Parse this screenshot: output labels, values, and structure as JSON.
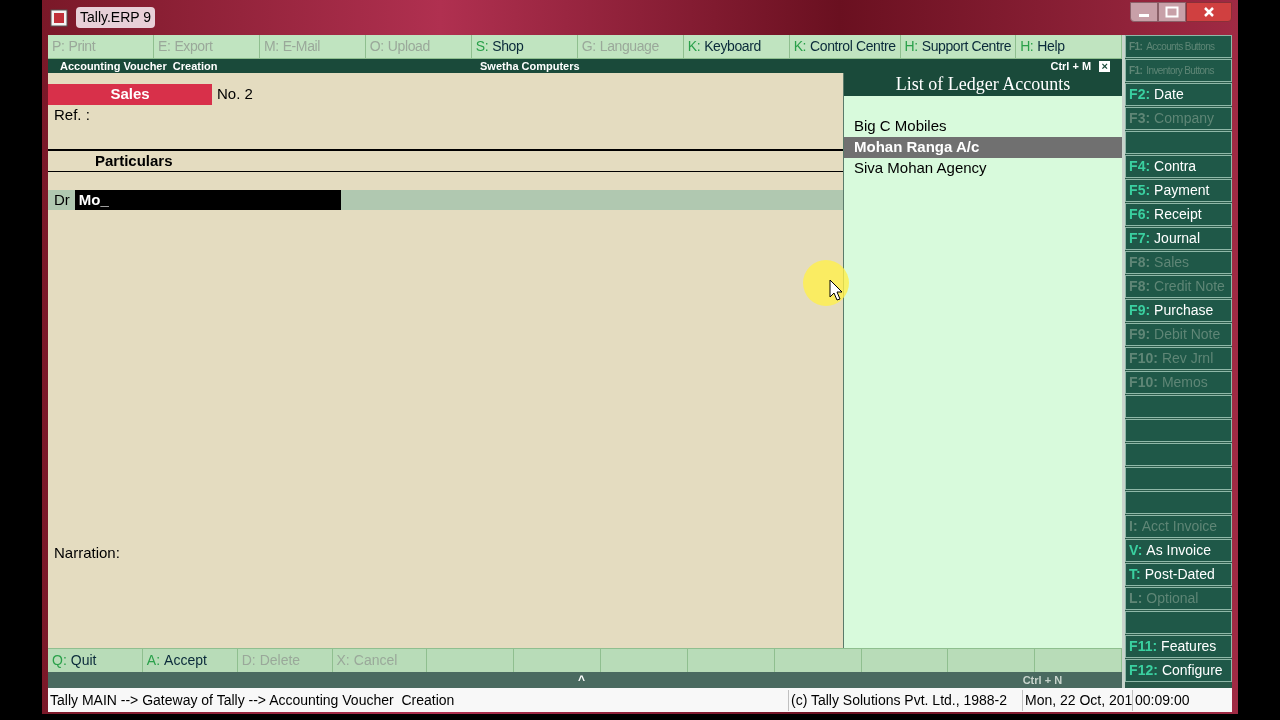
{
  "window": {
    "title": "Tally.ERP 9"
  },
  "top_buttons": [
    {
      "key": "P:",
      "label": "Print",
      "disabled": true
    },
    {
      "key": "E:",
      "label": "Export",
      "disabled": true
    },
    {
      "key": "M:",
      "label": "E-Mail",
      "disabled": true
    },
    {
      "key": "O:",
      "label": "Upload",
      "disabled": true
    },
    {
      "key": "S:",
      "label": "Shop",
      "disabled": false
    },
    {
      "key": "G:",
      "label": "Language",
      "disabled": true
    },
    {
      "key": "K:",
      "label": "Keyboard",
      "disabled": false
    },
    {
      "key": "K:",
      "label": "Control Centre",
      "disabled": false
    },
    {
      "key": "H:",
      "label": "Support Centre",
      "disabled": false
    },
    {
      "key": "H:",
      "label": "Help",
      "disabled": false
    }
  ],
  "header": {
    "title": "Accounting Voucher  Creation",
    "company": "Swetha Computers",
    "shortcut": "Ctrl + M",
    "close": "×"
  },
  "voucher": {
    "type": "Sales",
    "number": "No. 2",
    "ref_label": "Ref. :",
    "particulars_heading": "Particulars",
    "entry_label": "Dr",
    "entry_value": "Mo_",
    "narration_label": "Narration:"
  },
  "ledger_list": {
    "title": "List of Ledger Accounts",
    "items": [
      {
        "name": "Big C Mobiles",
        "selected": false
      },
      {
        "name": "Mohan Ranga A/c",
        "selected": true
      },
      {
        "name": "Siva Mohan Agency",
        "selected": false
      }
    ]
  },
  "side_buttons": [
    {
      "kind": "key",
      "key": "F1:",
      "label": "Accounts Buttons",
      "disabled": true
    },
    {
      "kind": "key",
      "key": "F1:",
      "label": "Inventory Buttons",
      "disabled": true
    },
    {
      "kind": "key",
      "key": "F2:",
      "label": "Date",
      "disabled": false
    },
    {
      "kind": "key",
      "key": "F3:",
      "label": "Company",
      "disabled": true
    },
    {
      "kind": "blank"
    },
    {
      "kind": "key",
      "key": "F4:",
      "label": "Contra",
      "disabled": false
    },
    {
      "kind": "key",
      "key": "F5:",
      "label": "Payment",
      "disabled": false
    },
    {
      "kind": "key",
      "key": "F6:",
      "label": "Receipt",
      "disabled": false
    },
    {
      "kind": "key",
      "key": "F7:",
      "label": "Journal",
      "disabled": false
    },
    {
      "kind": "key",
      "key": "F8:",
      "label": "Sales",
      "disabled": true
    },
    {
      "kind": "key",
      "key": "F8:",
      "label": "Credit Note",
      "disabled": true
    },
    {
      "kind": "key",
      "key": "F9:",
      "label": "Purchase",
      "disabled": false
    },
    {
      "kind": "key",
      "key": "F9:",
      "label": "Debit Note",
      "disabled": true
    },
    {
      "kind": "key",
      "key": "F10:",
      "label": "Rev Jrnl",
      "disabled": true
    },
    {
      "kind": "key",
      "key": "F10:",
      "label": "Memos",
      "disabled": true
    },
    {
      "kind": "blank"
    },
    {
      "kind": "blank"
    },
    {
      "kind": "blank"
    },
    {
      "kind": "blank"
    },
    {
      "kind": "blank"
    },
    {
      "kind": "key",
      "key": "I:",
      "label": "Acct Invoice",
      "disabled": true
    },
    {
      "kind": "key",
      "key": "V:",
      "label": "As Invoice",
      "disabled": false
    },
    {
      "kind": "key",
      "key": "T:",
      "label": "Post-Dated",
      "disabled": false
    },
    {
      "kind": "key",
      "key": "L:",
      "label": "Optional",
      "disabled": true
    },
    {
      "kind": "blank"
    },
    {
      "kind": "key",
      "key": "F11:",
      "label": "Features",
      "disabled": false
    },
    {
      "kind": "key",
      "key": "F12:",
      "label": "Configure",
      "disabled": false
    }
  ],
  "bottom_buttons": [
    {
      "kind": "key",
      "key": "Q:",
      "label": "Quit",
      "disabled": false
    },
    {
      "kind": "key",
      "key": "A:",
      "label": "Accept",
      "disabled": false
    },
    {
      "kind": "key",
      "key": "D:",
      "label": "Delete",
      "disabled": true
    },
    {
      "kind": "key",
      "key": "X:",
      "label": "Cancel",
      "disabled": true
    },
    {
      "kind": "blank"
    },
    {
      "kind": "blank"
    },
    {
      "kind": "blank"
    },
    {
      "kind": "blank"
    },
    {
      "kind": "blank"
    },
    {
      "kind": "blank"
    },
    {
      "kind": "blank"
    },
    {
      "kind": "blank"
    }
  ],
  "bottom_bar": {
    "toggle": "^",
    "shortcut": "Ctrl + N"
  },
  "status_bar": {
    "path": "Tally MAIN --> Gateway of Tally --> Accounting Voucher  Creation",
    "copyright": "(c) Tally Solutions Pvt. Ltd., 1988-2",
    "date": "Mon, 22 Oct, 201",
    "time": "00:09:00"
  }
}
